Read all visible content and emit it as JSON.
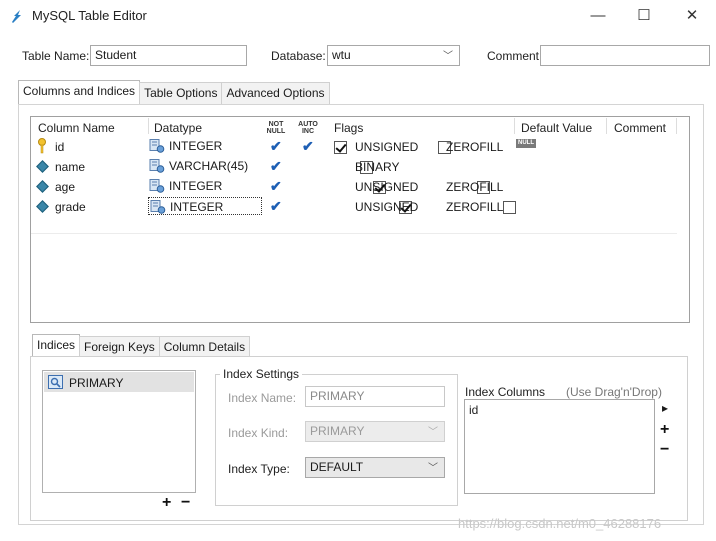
{
  "window": {
    "title": "MySQL Table Editor",
    "minimize": "—",
    "maximize": "☐",
    "close": "✕"
  },
  "header": {
    "table_name_label": "Table Name:",
    "table_name_value": "Student",
    "database_label": "Database:",
    "database_value": "wtu",
    "comment_label": "Comment:",
    "comment_value": ""
  },
  "main_tabs": [
    "Columns and Indices",
    "Table Options",
    "Advanced Options"
  ],
  "columns_grid": {
    "headers": {
      "column_name": "Column Name",
      "datatype": "Datatype",
      "not_null": "NOT NULL",
      "not_null_1": "NOT",
      "not_null_2": "NULL",
      "auto_inc_1": "AUTO",
      "auto_inc_2": "INC",
      "flags": "Flags",
      "default_value": "Default Value",
      "comment": "Comment"
    },
    "rows": [
      {
        "name": "id",
        "key": "primary",
        "datatype": "INTEGER",
        "not_null": true,
        "auto_inc": true,
        "flag1": "UNSIGNED",
        "flag1_on": true,
        "flag2": "ZEROFILL",
        "flag2_on": false,
        "default": "NULL"
      },
      {
        "name": "name",
        "key": "column",
        "datatype": "VARCHAR(45)",
        "not_null": true,
        "auto_inc": false,
        "flag1": "BINARY",
        "flag1_on": false,
        "flag2": "",
        "flag2_on": false,
        "default": ""
      },
      {
        "name": "age",
        "key": "column",
        "datatype": "INTEGER",
        "not_null": true,
        "auto_inc": false,
        "flag1": "UNSIGNED",
        "flag1_on": true,
        "flag2": "ZEROFILL",
        "flag2_on": false,
        "default": ""
      },
      {
        "name": "grade",
        "key": "column",
        "datatype": "INTEGER",
        "not_null": true,
        "auto_inc": false,
        "flag1": "UNSIGNED",
        "flag1_on": true,
        "flag2": "ZEROFILL",
        "flag2_on": false,
        "default": ""
      }
    ]
  },
  "sub_tabs": [
    "Indices",
    "Foreign Keys",
    "Column Details"
  ],
  "indices": {
    "list": [
      "PRIMARY"
    ],
    "add": "+",
    "remove": "−",
    "settings_title": "Index Settings",
    "index_name_label": "Index Name:",
    "index_name_value": "PRIMARY",
    "index_kind_label": "Index Kind:",
    "index_kind_value": "PRIMARY",
    "index_type_label": "Index Type:",
    "index_type_value": "DEFAULT",
    "columns_label": "Index Columns",
    "columns_hint": "(Use Drag'n'Drop)",
    "columns": [
      "id"
    ],
    "side_move": "▸",
    "side_add": "+",
    "side_remove": "−"
  },
  "watermark": "https://blog.csdn.net/m0_46288176",
  "colors": {
    "check_blue": "#1e5fb4",
    "key_yellow": "#f2c230",
    "diamond": "#3a86a8"
  }
}
